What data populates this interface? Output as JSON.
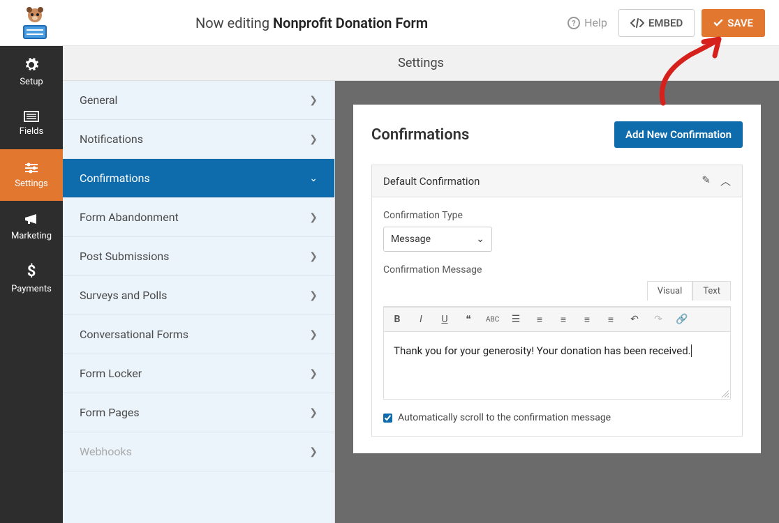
{
  "header": {
    "editing_prefix": "Now editing ",
    "form_name": "Nonprofit Donation Form",
    "help": "Help",
    "embed": "EMBED",
    "save": "SAVE"
  },
  "sidenav": {
    "setup": "Setup",
    "fields": "Fields",
    "settings": "Settings",
    "marketing": "Marketing",
    "payments": "Payments"
  },
  "subheader": "Settings",
  "settings_menu": {
    "general": "General",
    "notifications": "Notifications",
    "confirmations": "Confirmations",
    "form_abandonment": "Form Abandonment",
    "post_submissions": "Post Submissions",
    "surveys_polls": "Surveys and Polls",
    "conversational": "Conversational Forms",
    "form_locker": "Form Locker",
    "form_pages": "Form Pages",
    "webhooks": "Webhooks"
  },
  "panel": {
    "title": "Confirmations",
    "add_new": "Add New Confirmation",
    "default_name": "Default Confirmation",
    "type_label": "Confirmation Type",
    "type_value": "Message",
    "message_label": "Confirmation Message",
    "tabs": {
      "visual": "Visual",
      "text": "Text"
    },
    "message_content": "Thank you for your generosity! Your donation has been received.",
    "auto_scroll": "Automatically scroll to the confirmation message"
  }
}
